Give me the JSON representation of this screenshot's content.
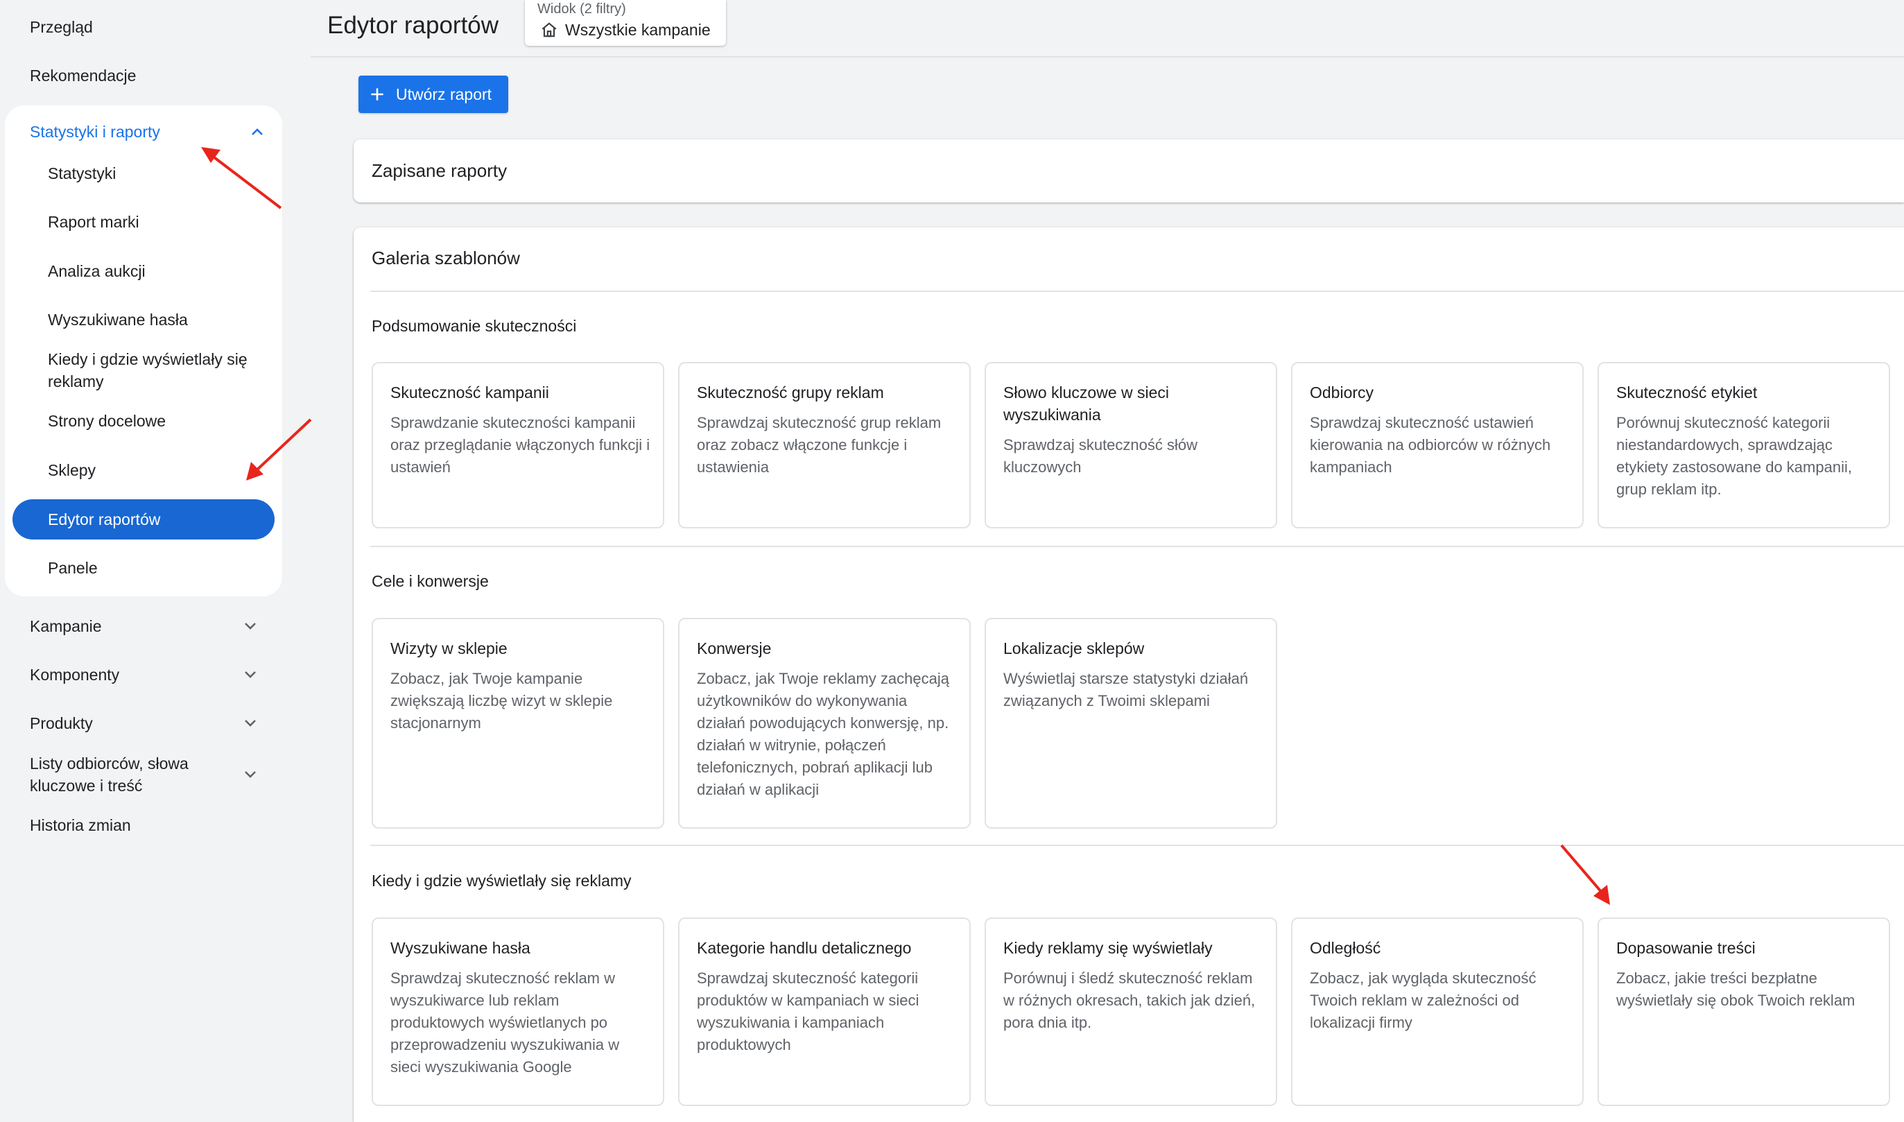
{
  "sidebar": {
    "top_items": [
      "Przegląd",
      "Rekomendacje"
    ],
    "stats_group": {
      "label": "Statystyki i raporty",
      "items": [
        "Statystyki",
        "Raport marki",
        "Analiza aukcji",
        "Wyszukiwane hasła",
        "Kiedy i gdzie wyświetlały się reklamy",
        "Strony docelowe",
        "Sklepy",
        "Edytor raportów",
        "Panele"
      ],
      "active_item": "Edytor raportów"
    },
    "bottom_items": [
      "Kampanie",
      "Komponenty",
      "Produkty",
      "Listy odbiorców, słowa kluczowe i treść",
      "Historia zmian"
    ]
  },
  "header": {
    "title": "Edytor raportów",
    "view": {
      "label": "Widok (2 filtry)",
      "value": "Wszystkie kampanie",
      "icon": "home-icon"
    }
  },
  "toolbar": {
    "create_label": "Utwórz raport"
  },
  "saved_reports": {
    "title": "Zapisane raporty"
  },
  "gallery": {
    "title": "Galeria szablonów",
    "sections": [
      {
        "title": "Podsumowanie skuteczności",
        "cards": [
          {
            "title": "Skuteczność kampanii",
            "desc": "Sprawdzanie skuteczności kampanii oraz przeglądanie włączonych funkcji i ustawień"
          },
          {
            "title": "Skuteczność grupy reklam",
            "desc": "Sprawdzaj skuteczność grup reklam oraz zobacz włączone funkcje i ustawienia"
          },
          {
            "title": "Słowo kluczowe w sieci wyszukiwania",
            "desc": "Sprawdzaj skuteczność słów kluczowych"
          },
          {
            "title": "Odbiorcy",
            "desc": "Sprawdzaj skuteczność ustawień kierowania na odbiorców w różnych kampaniach"
          },
          {
            "title": "Skuteczność etykiet",
            "desc": "Porównuj skuteczność kategorii niestandardowych, sprawdzając etykiety zastosowane do kampanii, grup reklam itp."
          }
        ]
      },
      {
        "title": "Cele i konwersje",
        "cards": [
          {
            "title": "Wizyty w sklepie",
            "desc": "Zobacz, jak Twoje kampanie zwiększają liczbę wizyt w sklepie stacjonarnym"
          },
          {
            "title": "Konwersje",
            "desc": "Zobacz, jak Twoje reklamy zachęcają użytkowników do wykonywania działań powodujących konwersję, np. działań w witrynie, połączeń telefonicznych, pobrań aplikacji lub działań w aplikacji"
          },
          {
            "title": "Lokalizacje sklepów",
            "desc": "Wyświetlaj starsze statystyki działań związanych z Twoimi sklepami"
          }
        ]
      },
      {
        "title": "Kiedy i gdzie wyświetlały się reklamy",
        "cards": [
          {
            "title": "Wyszukiwane hasła",
            "desc": "Sprawdzaj skuteczność reklam w wyszukiwarce lub reklam produktowych wyświetlanych po przeprowadzeniu wyszukiwania w sieci wyszukiwania Google"
          },
          {
            "title": "Kategorie handlu detalicznego",
            "desc": "Sprawdzaj skuteczność kategorii produktów w kampaniach w sieci wyszukiwania i kampaniach produktowych"
          },
          {
            "title": "Kiedy reklamy się wyświetlały",
            "desc": "Porównuj i śledź skuteczność reklam w różnych okresach, takich jak dzień, pora dnia itp."
          },
          {
            "title": "Odległość",
            "desc": "Zobacz, jak wygląda skuteczność Twoich reklam w zależności od lokalizacji firmy"
          },
          {
            "title": "Dopasowanie treści",
            "desc": "Zobacz, jakie treści bezpłatne wyświetlały się obok Twoich reklam"
          }
        ]
      }
    ]
  },
  "colors": {
    "accent": "#1a73e8",
    "active_bg": "#1967d2",
    "annotation_arrow": "#e8251c"
  }
}
